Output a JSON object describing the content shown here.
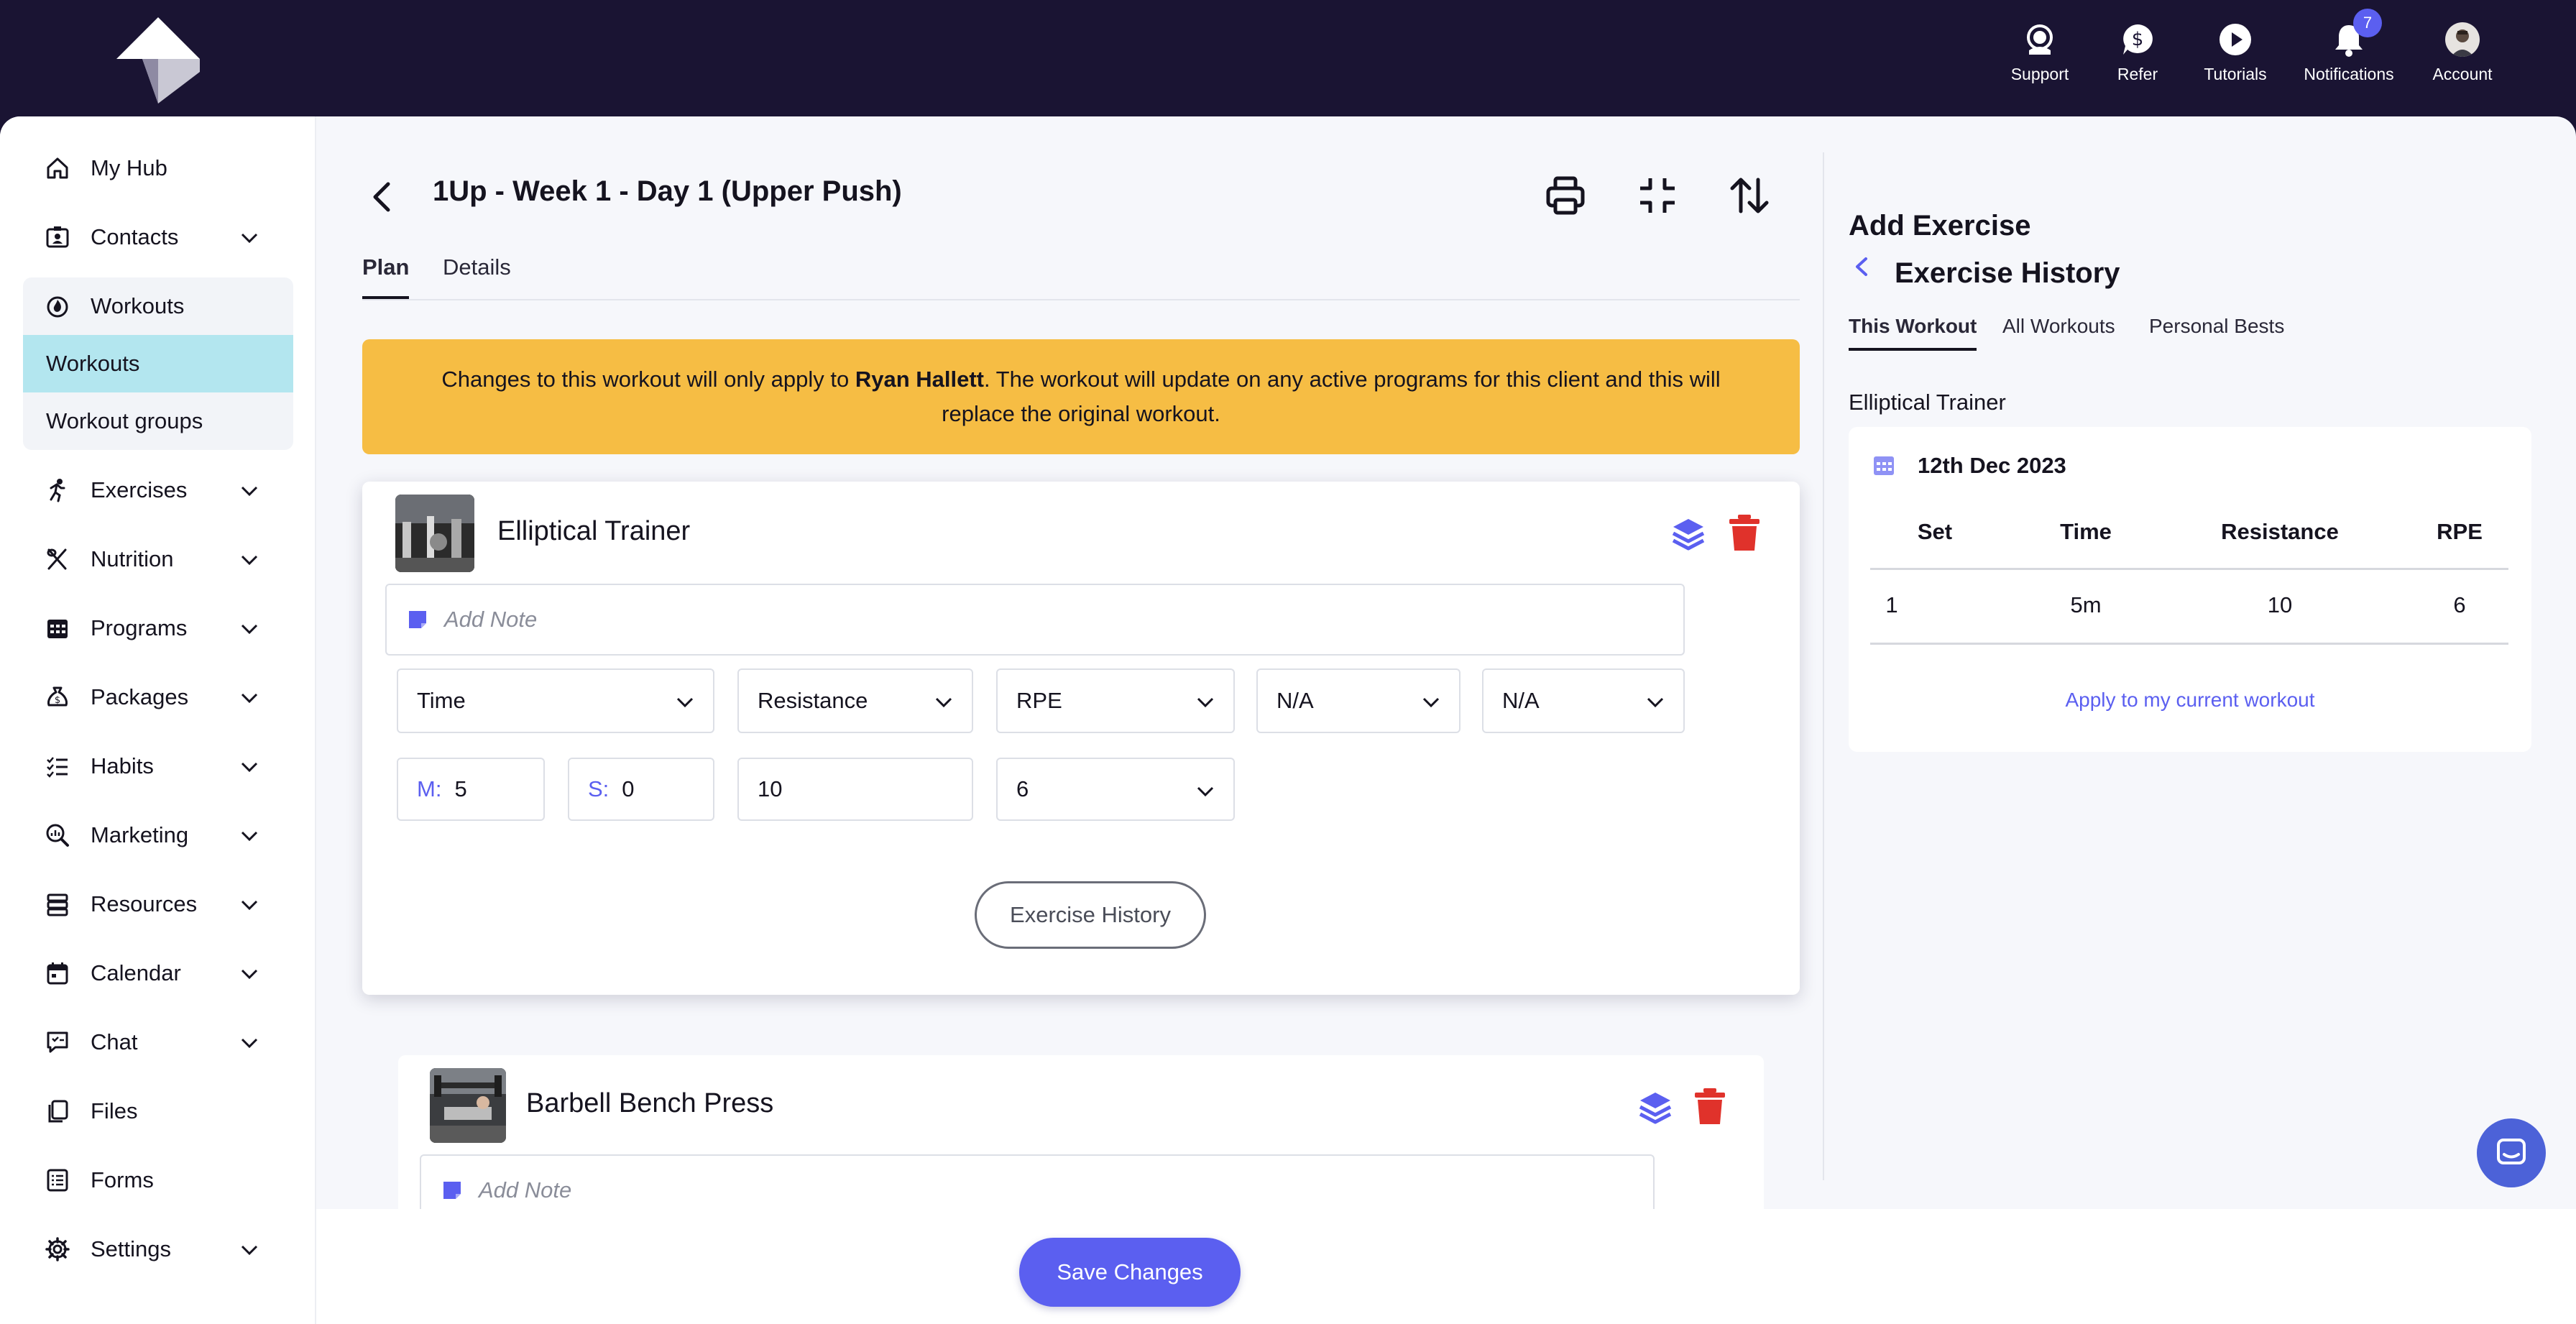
{
  "topnav": {
    "items": [
      {
        "label": "Support",
        "icon": "headset-icon"
      },
      {
        "label": "Refer",
        "icon": "dollar-bubble-icon"
      },
      {
        "label": "Tutorials",
        "icon": "play-icon"
      },
      {
        "label": "Notifications",
        "icon": "bell-icon",
        "badge": "7"
      },
      {
        "label": "Account",
        "icon": "avatar"
      }
    ]
  },
  "sidebar": {
    "items": [
      {
        "label": "My Hub",
        "icon": "home-icon"
      },
      {
        "label": "Contacts",
        "icon": "contacts-icon"
      },
      {
        "label": "Workouts",
        "icon": "flame-icon"
      },
      {
        "label": "Exercises",
        "icon": "runner-icon"
      },
      {
        "label": "Nutrition",
        "icon": "utensils-icon"
      },
      {
        "label": "Programs",
        "icon": "calendar-grid-icon"
      },
      {
        "label": "Packages",
        "icon": "money-bag-icon"
      },
      {
        "label": "Habits",
        "icon": "checklist-icon"
      },
      {
        "label": "Marketing",
        "icon": "search-chart-icon"
      },
      {
        "label": "Resources",
        "icon": "stack-icon"
      },
      {
        "label": "Calendar",
        "icon": "calendar-icon"
      },
      {
        "label": "Chat",
        "icon": "chat-icon"
      },
      {
        "label": "Files",
        "icon": "files-icon"
      },
      {
        "label": "Forms",
        "icon": "form-icon"
      },
      {
        "label": "Settings",
        "icon": "gear-icon"
      }
    ],
    "workouts_sub": [
      "Workouts",
      "Workout groups"
    ]
  },
  "header": {
    "title": "1Up - Week 1 - Day 1 (Upper Push)",
    "tabs": [
      "Plan",
      "Details"
    ]
  },
  "banner": {
    "prefix": "Changes to this workout will only apply to ",
    "client": "Ryan Hallett",
    "suffix": ". The workout will update on any active programs for this client and this will replace the original workout."
  },
  "exercise1": {
    "name": "Elliptical Trainer",
    "note_placeholder": "Add Note",
    "columns": [
      "Time",
      "Resistance",
      "RPE",
      "N/A",
      "N/A"
    ],
    "minutes_prefix": "M:",
    "minutes": "5",
    "seconds_prefix": "S:",
    "seconds": "0",
    "resistance": "10",
    "rpe": "6",
    "history_button": "Exercise History"
  },
  "exercise2": {
    "name": "Barbell Bench Press",
    "note_placeholder": "Add Note"
  },
  "footer": {
    "save_label": "Save Changes"
  },
  "right_panel": {
    "title": "Add Exercise",
    "subtitle": "Exercise History",
    "tabs": [
      "This Workout",
      "All Workouts",
      "Personal Bests"
    ],
    "exercise_label": "Elliptical Trainer",
    "entry": {
      "date": "12th Dec 2023",
      "headers": [
        "Set",
        "Time",
        "Resistance",
        "RPE"
      ],
      "row": [
        "1",
        "5m",
        "10",
        "6"
      ]
    },
    "apply_link": "Apply to my current workout"
  },
  "colors": {
    "topbar": "#1a1433",
    "accent": "#5b5ff0",
    "banner": "#f6bd44",
    "active_sub": "#b3e6ef",
    "danger": "#e0322b"
  }
}
